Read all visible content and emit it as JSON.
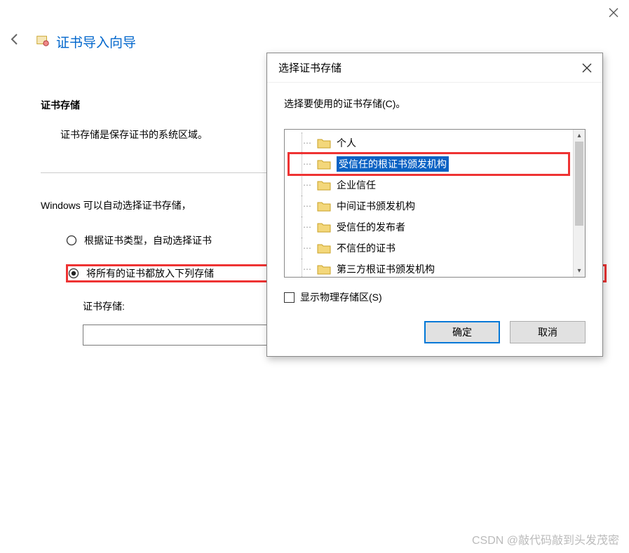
{
  "wizard": {
    "title": "证书导入向导",
    "section_title": "证书存储",
    "section_desc": "证书存储是保存证书的系统区域。",
    "info_text": "Windows 可以自动选择证书存储，",
    "radio_auto": "根据证书类型，自动选择证书",
    "radio_place": "将所有的证书都放入下列存储",
    "store_label": "证书存储:"
  },
  "dialog": {
    "title": "选择证书存储",
    "desc": "选择要使用的证书存储(C)。",
    "tree_items": [
      "个人",
      "受信任的根证书颁发机构",
      "企业信任",
      "中间证书颁发机构",
      "受信任的发布者",
      "不信任的证书",
      "第三方根证书颁发机构"
    ],
    "show_physical": "显示物理存储区(S)",
    "ok": "确定",
    "cancel": "取消"
  },
  "watermark": "CSDN @敲代码敲到头发茂密"
}
